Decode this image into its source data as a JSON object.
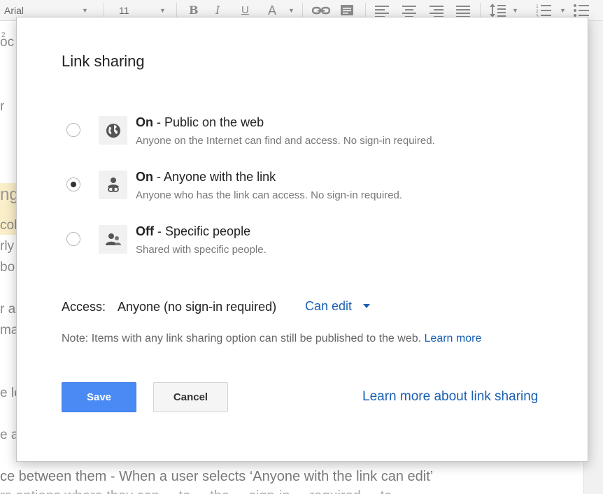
{
  "toolbar": {
    "font_name": "Arial",
    "font_size": "11",
    "bold_label": "B",
    "italic_label": "I",
    "underline_label": "U",
    "text_color_label": "A",
    "ruler_mark": "2"
  },
  "document": {
    "fragments": [
      "oc",
      "r",
      "ng",
      "coll",
      "rly",
      "bo",
      "r a",
      "ma",
      "e le",
      "e a"
    ],
    "bottom_line": "ce between them - When a user selects ‘Anyone with the link can edit’",
    "bottom_line_2": "rs options where they can  ...  to  ...  the  ...  sign-in  ...  required  ...  to"
  },
  "dialog": {
    "title": "Link sharing",
    "options": [
      {
        "state": "On",
        "label": " - Public on the web",
        "description": "Anyone on the Internet can find and access. No sign-in required.",
        "icon": "globe-icon",
        "selected": false
      },
      {
        "state": "On",
        "label": " - Anyone with the link",
        "description": "Anyone who has the link can access. No sign-in required.",
        "icon": "person-link-icon",
        "selected": true
      },
      {
        "state": "Off",
        "label": " - Specific people",
        "description": "Shared with specific people.",
        "icon": "people-icon",
        "selected": false
      }
    ],
    "access_label": "Access:",
    "access_value": "Anyone (no sign-in required)",
    "permission": "Can edit",
    "note_text": "Note: Items with any link sharing option can still be published to the web. ",
    "note_link": "Learn more",
    "save_label": "Save",
    "cancel_label": "Cancel",
    "learn_more_label": "Learn more about link sharing"
  },
  "colors": {
    "link": "#1a5fb4",
    "primary_button": "#4a8af4"
  }
}
